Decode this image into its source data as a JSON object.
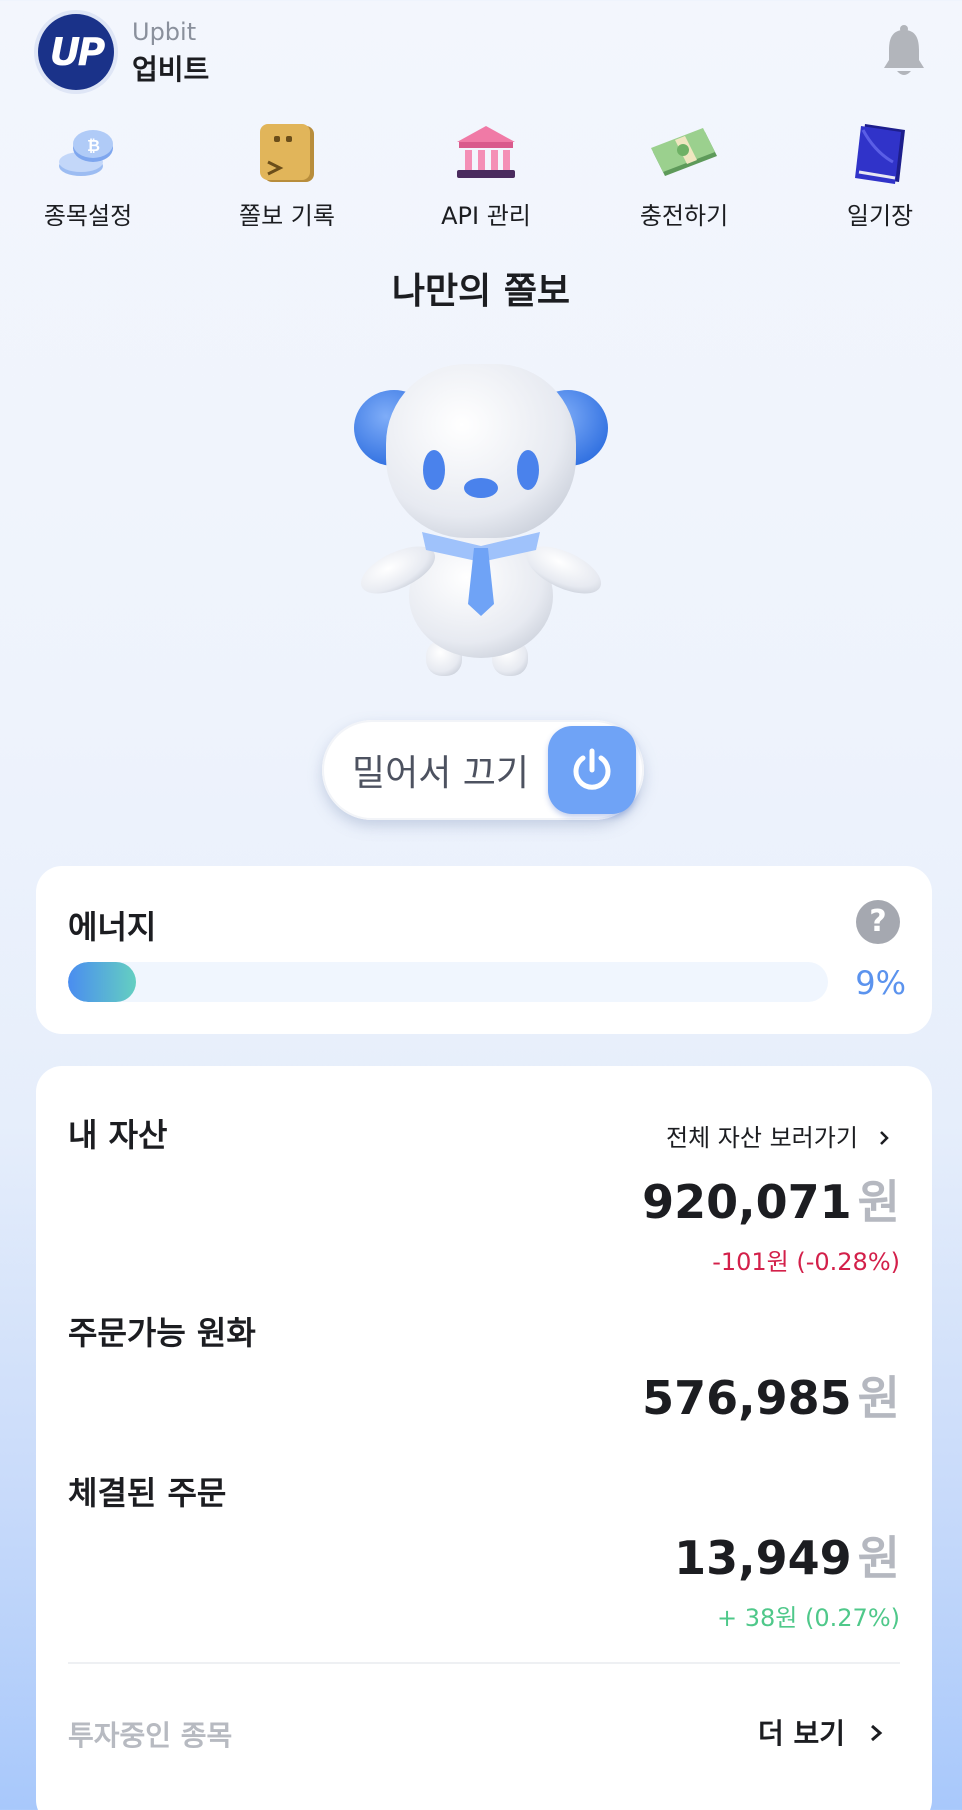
{
  "header": {
    "logo_text": "UP",
    "brand_en": "Upbit",
    "brand_ko": "업비트"
  },
  "menu": [
    {
      "label": "종목설정",
      "icon": "coins-icon"
    },
    {
      "label": "쫄보 기록",
      "icon": "box-icon"
    },
    {
      "label": "API 관리",
      "icon": "bank-icon"
    },
    {
      "label": "충전하기",
      "icon": "cash-icon"
    },
    {
      "label": "일기장",
      "icon": "diary-icon"
    }
  ],
  "section_title": "나만의 쫄보",
  "slide_toggle": {
    "label": "밀어서 끄기"
  },
  "energy": {
    "title": "에너지",
    "help": "?",
    "percent_label": "9%",
    "percent_value": 9
  },
  "assets": {
    "my_assets_label": "내 자산",
    "see_all_label": "전체 자산 보러가기",
    "total_amount": "920,071",
    "unit": "원",
    "total_change": "-101원 (-0.28%)",
    "krw_label": "주문가능 원화",
    "krw_amount": "576,985",
    "filled_label": "체결된 주문",
    "filled_amount": "13,949",
    "filled_change": "+ 38원 (0.27%)",
    "investing_label": "투자중인 종목",
    "more_label": "더 보기"
  },
  "colors": {
    "brand": "#1a3289",
    "accent": "#6fa3f6",
    "negative": "#d3204a",
    "positive": "#4fc88a"
  }
}
